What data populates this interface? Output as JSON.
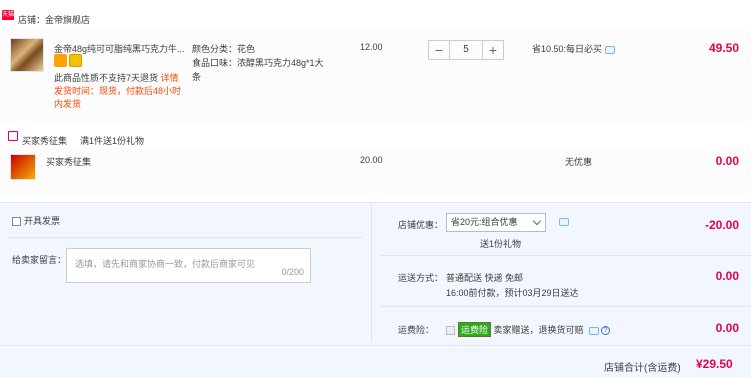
{
  "shop": {
    "badge": "天猫",
    "name": "店铺：金帝旗舰店"
  },
  "item1": {
    "title": "金帝48g纯可可脂纯黑巧克力牛...",
    "notice1": "此商品性质不支持7天退货",
    "notice_link": "详情",
    "delivery": "发货时间：现货，付款后48小时内发货",
    "attr1": "颜色分类：花色",
    "attr2": "食品口味：浓醇黑巧克力48g*1大条",
    "unit_price": "12.00",
    "qty": "5",
    "minus": "−",
    "plus": "+",
    "save": "省10.50:每日必买",
    "total": "49.50"
  },
  "gift": {
    "label": "买家秀征集",
    "desc": "满1件送1份礼物"
  },
  "item2": {
    "title": "买家秀征集",
    "unit_price": "20.00",
    "discount": "无优惠",
    "total": "0.00"
  },
  "invoice": {
    "label": "开具发票"
  },
  "message": {
    "label": "给卖家留言：",
    "placeholder": "选填，请先和商家协商一致，付款后商家可见",
    "count": "0/200"
  },
  "promo": {
    "label": "店铺优惠：",
    "selected": "省20元:组合优惠",
    "gift_note": "送1份礼物",
    "value": "-20.00"
  },
  "shipping": {
    "label": "运送方式：",
    "line1": "普通配送 快递 免邮",
    "line2": "16:00前付款，预计03月29日送达",
    "value": "0.00"
  },
  "insurance": {
    "label": "运费险：",
    "tag": "运费险",
    "desc": "卖家赠送，退换货可赔",
    "help": "?",
    "value": "0.00"
  },
  "summary": {
    "label": "店铺合计(含运费)",
    "value": "¥29.50"
  }
}
